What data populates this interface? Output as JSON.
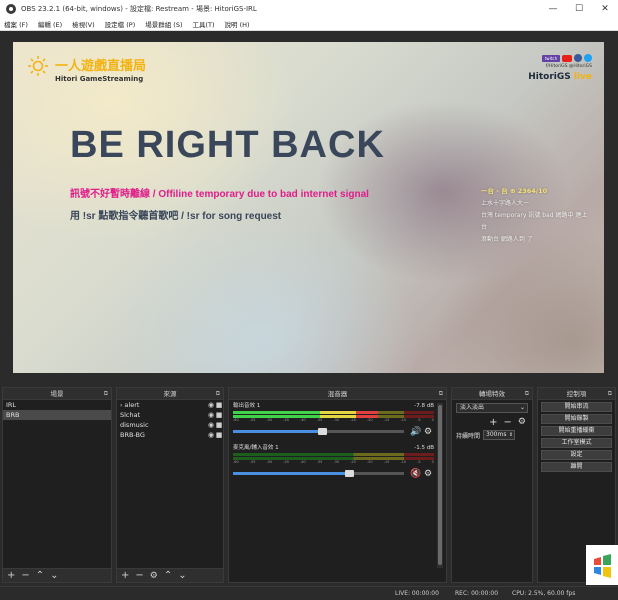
{
  "window": {
    "title": "OBS 23.2.1 (64-bit, windows) - 設定檔: Restream - 場景: HitoriGS-IRL",
    "minimize": "—",
    "maximize": "☐",
    "close": "✕"
  },
  "menu": [
    "檔案 (F)",
    "編輯 (E)",
    "檢視(V)",
    "設定檔 (P)",
    "場景群組 (S)",
    "工具(T)",
    "說明 (H)"
  ],
  "preview": {
    "logo_title": "一人遊戲直播局",
    "logo_subtitle": "Hitori GameStreaming",
    "social_twitch": "twitch",
    "social_handle": "f/HitoriGS @HitoriGS",
    "social_name": "HitoriGS",
    "social_name_accent": "live",
    "headline": "BE RIGHT BACK",
    "message_1": "訊號不好暫時離線 / Offiline temporary due to bad internet signal",
    "message_2": "用 !sr 點歌指令聽首歌吧  / !sr for song request",
    "chat": [
      "一台 - 台 ⊕ 2364/10",
      "上水十字路人大一",
      "台灣 temporary 訊號 bad 網路中 連上",
      "台",
      "滾動台 網路人到 了"
    ],
    "colors": {
      "headline": "#3a4659",
      "message_1": "#e01d8a",
      "logo": "#f3b312"
    }
  },
  "panels": {
    "scenes": {
      "title": "場景",
      "items": [
        "IRL",
        "BRB"
      ],
      "selected_index": 1
    },
    "sources": {
      "title": "來源",
      "items": [
        "alert",
        "Slchat",
        "dismusic",
        "BRB-BG"
      ]
    },
    "mixer": {
      "title": "混音器",
      "channels": [
        {
          "name": "輸出音效 1",
          "db": "-7.8 dB",
          "level_percent": 72,
          "volume_percent": 52,
          "muted": false
        },
        {
          "name": "麥克風/輔入音效 1",
          "db": "-1.5 dB",
          "level_percent": 0,
          "volume_percent": 68,
          "muted": true
        }
      ],
      "ticks": [
        "-60",
        "-55",
        "-50",
        "-45",
        "-40",
        "-35",
        "-30",
        "-25",
        "-20",
        "-15",
        "-10",
        "-5",
        "0"
      ]
    },
    "transitions": {
      "title": "轉場特效",
      "selected": "淡入淡出",
      "duration_label": "持續時間",
      "duration_value": "300ms"
    },
    "controls": {
      "title": "控制項",
      "buttons": [
        "開始串流",
        "開始錄製",
        "開始重播緩衝",
        "工作室模式",
        "設定",
        "離開"
      ]
    }
  },
  "status": {
    "live": "LIVE: 00:00:00",
    "rec": "REC: 00:00:00",
    "cpu": "CPU: 2.5%, 60.00 fps"
  }
}
